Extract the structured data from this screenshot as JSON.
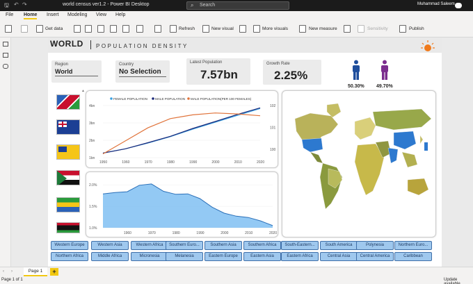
{
  "window": {
    "title": "world census ver1.2 - Power BI Desktop",
    "search_placeholder": "Search",
    "user": "Muhammad Saleem"
  },
  "menu": [
    "File",
    "Home",
    "Insert",
    "Modeling",
    "View",
    "Help"
  ],
  "ribbon": {
    "get_data": "Get data",
    "refresh": "Refresh",
    "new_visual": "New visual",
    "more_visuals": "More visuals",
    "new_measure": "New measure",
    "sensitivity": "Sensitivity",
    "publish": "Publish"
  },
  "report": {
    "header": {
      "title": "WORLD",
      "subtitle": "POPULATION DENSITY"
    },
    "cards": {
      "region": {
        "label": "Region",
        "value": "World"
      },
      "country": {
        "label": "Country",
        "value": "No Selection"
      },
      "latest": {
        "label": "Latest Population",
        "value": "7.57bn"
      },
      "growth": {
        "label": "Growth Rate",
        "value": "2.25%"
      }
    },
    "gender": {
      "male_pct": "50.30%",
      "female_pct": "49.70%",
      "male_color": "#1f4e9c",
      "female_color": "#7b2d8e"
    },
    "region_buttons": [
      "Western Europe",
      "Western Asia",
      "Western Africa",
      "Southern Euro...",
      "Southern Asia",
      "Southern Africa",
      "South-Eastern...",
      "South America",
      "Polynesia",
      "Northern Euro...",
      "Northern Africa",
      "Middle Africa",
      "Micronesia",
      "Melanesia",
      "Eastern Europe",
      "Eastern Asia",
      "Eastern Africa",
      "Central Asia",
      "Central America",
      "Caribbean"
    ]
  },
  "chart_data": [
    {
      "type": "line",
      "legend": [
        "FEMALE POPULATION",
        "MALE POPULATION",
        "MALE POPULATION(PER 100 FEMALES)"
      ],
      "x": [
        1950,
        1960,
        1970,
        1980,
        1990,
        2000,
        2010,
        2020
      ],
      "xlim": [
        1950,
        2020
      ],
      "y_ticks": [
        "1bn",
        "2bn",
        "3bn",
        "4bn"
      ],
      "y2_ticks": [
        "100",
        "101",
        "102"
      ],
      "series": [
        {
          "name": "FEMALE POPULATION",
          "color": "#3aa0e0",
          "values": [
            1.27,
            1.51,
            1.84,
            2.21,
            2.64,
            3.04,
            3.44,
            3.83
          ]
        },
        {
          "name": "MALE POPULATION",
          "color": "#1c2a7a",
          "values": [
            1.26,
            1.51,
            1.86,
            2.23,
            2.68,
            3.08,
            3.49,
            3.87
          ]
        },
        {
          "name": "MALE POPULATION(PER 100 FEMALES)",
          "color": "#e0733a",
          "axis": "y2",
          "values": [
            99.6,
            100.3,
            101.0,
            101.5,
            101.7,
            101.8,
            101.75,
            101.65
          ]
        }
      ]
    },
    {
      "type": "area",
      "x": [
        1950,
        1955,
        1960,
        1965,
        1970,
        1975,
        1980,
        1985,
        1990,
        1995,
        2000,
        2005,
        2010,
        2015,
        2020
      ],
      "xlim": [
        1950,
        2020
      ],
      "y_ticks": [
        "1.0%",
        "1.5%",
        "2.0%"
      ],
      "ylim": [
        1.0,
        2.1
      ],
      "series": [
        {
          "name": "Growth Rate",
          "color": "#6fb7f0",
          "values": [
            1.79,
            1.82,
            1.84,
            1.99,
            2.02,
            1.85,
            1.78,
            1.79,
            1.68,
            1.48,
            1.34,
            1.27,
            1.24,
            1.16,
            1.05
          ]
        }
      ]
    }
  ],
  "tabs": {
    "page1": "Page 1",
    "add": "+"
  },
  "status": {
    "left": "Page 1 of 1",
    "right": "Update available"
  }
}
